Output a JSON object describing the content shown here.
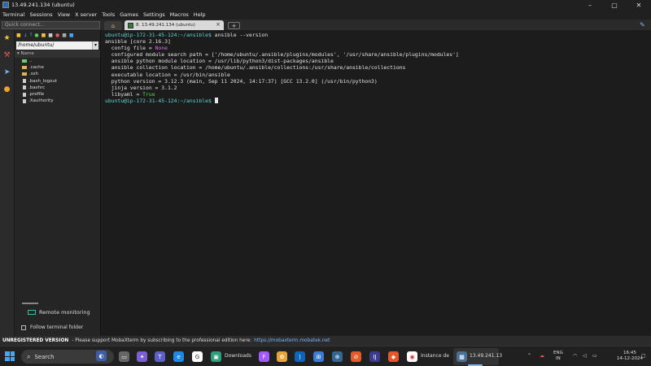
{
  "window": {
    "title": "13.49.241.134 (ubuntu)",
    "controls": [
      "–",
      "▢",
      "✕"
    ]
  },
  "menu": [
    "Terminal",
    "Sessions",
    "View",
    "X server",
    "Tools",
    "Games",
    "Settings",
    "Macros",
    "Help"
  ],
  "quick_connect": {
    "placeholder": "Quick connect..."
  },
  "tabs": {
    "session_label": "8. 13.49.241.134 (ubuntu)",
    "close": "×",
    "new_tab": "+"
  },
  "sidebar": {
    "path": "/home/ubuntu/",
    "column_header": "Name",
    "items": [
      {
        "name": "..",
        "type": "folder"
      },
      {
        "name": ".cache",
        "type": "folder"
      },
      {
        "name": ".ssh",
        "type": "folder"
      },
      {
        "name": ".bash_logout",
        "type": "file"
      },
      {
        "name": ".bashrc",
        "type": "file"
      },
      {
        "name": ".profile",
        "type": "file"
      },
      {
        "name": ".Xauthority",
        "type": "file"
      }
    ],
    "remote_monitoring": "Remote monitoring",
    "follow_terminal": "Follow terminal folder"
  },
  "terminal": {
    "lines": [
      {
        "prompt": "ubuntu@ip-172-31-45-124:~/ansible$",
        "cmd": " ansible --version"
      },
      {
        "text": "ansible [core 2.16.3]"
      },
      {
        "key": "  config file = ",
        "val": "None",
        "val_color": "magenta"
      },
      {
        "text": "  configured module search path = ['/home/ubuntu/.ansible/plugins/modules', '/usr/share/ansible/plugins/modules']"
      },
      {
        "text": "  ansible python module location = /usr/lib/python3/dist-packages/ansible"
      },
      {
        "text": "  ansible collection location = /home/ubuntu/.ansible/collections:/usr/share/ansible/collections"
      },
      {
        "text": "  executable location = /usr/bin/ansible"
      },
      {
        "text": "  python version = 3.12.3 (main, Sep 11 2024, 14:17:37) [GCC 13.2.0] (/usr/bin/python3)"
      },
      {
        "text": "  jinja version = 3.1.2"
      },
      {
        "key": "  libyaml = ",
        "val": "True",
        "val_color": "green"
      },
      {
        "prompt": "ubuntu@ip-172-31-45-124:~/ansible$",
        "cmd": " ",
        "cursor": true
      }
    ]
  },
  "statusbar": {
    "unregistered": "UNREGISTERED VERSION",
    "message": "-  Please support MobaXterm by subscribing to the professional edition here:",
    "link": "https://mobaxterm.mobatek.net"
  },
  "taskbar": {
    "search_label": "Search",
    "downloads_label": "Downloads",
    "instance_label": "Instance de",
    "mobaxterm_label": "13.49.241.13",
    "lang_line1": "ENG",
    "lang_line2": "IN",
    "time": "16:45",
    "date": "14-12-2024"
  },
  "colors": {
    "prompt": "#5fd7d7",
    "none_value": "#e06cf0",
    "true_value": "#55d455",
    "link": "#7ab8ff"
  }
}
